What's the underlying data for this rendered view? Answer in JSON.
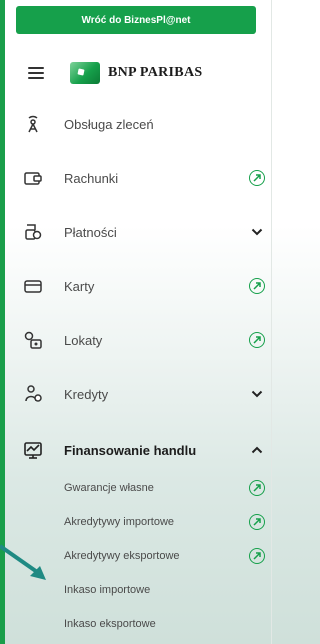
{
  "top_bar": {
    "label": "Wróć do BiznesPl@net"
  },
  "header": {
    "brand": "BNP PARIBAS"
  },
  "menu": {
    "items": [
      {
        "label": "Obsługa zleceń",
        "icon": "antenna-icon",
        "right": ""
      },
      {
        "label": "Rachunki",
        "icon": "account-icon",
        "right": "external-link-icon"
      },
      {
        "label": "Płatności",
        "icon": "payments-icon",
        "right": "chevron-down-icon"
      },
      {
        "label": "Karty",
        "icon": "card-icon",
        "right": "external-link-icon"
      },
      {
        "label": "Lokaty",
        "icon": "deposit-icon",
        "right": "external-link-icon"
      },
      {
        "label": "Kredyty",
        "icon": "loan-icon",
        "right": "chevron-down-icon"
      },
      {
        "label": "Finansowanie handlu",
        "icon": "trade-chart-icon",
        "right": "chevron-up-icon"
      }
    ],
    "subitems": [
      {
        "label": "Gwarancje własne",
        "right": "external-link-icon"
      },
      {
        "label": "Akredytywy importowe",
        "right": "external-link-icon"
      },
      {
        "label": "Akredytywy eksportowe",
        "right": "external-link-icon"
      },
      {
        "label": "Inkaso importowe",
        "right": ""
      },
      {
        "label": "Inkaso eksportowe",
        "right": ""
      }
    ]
  },
  "colors": {
    "brand_green": "#16a04b",
    "arrow_teal": "#1f8a83"
  }
}
